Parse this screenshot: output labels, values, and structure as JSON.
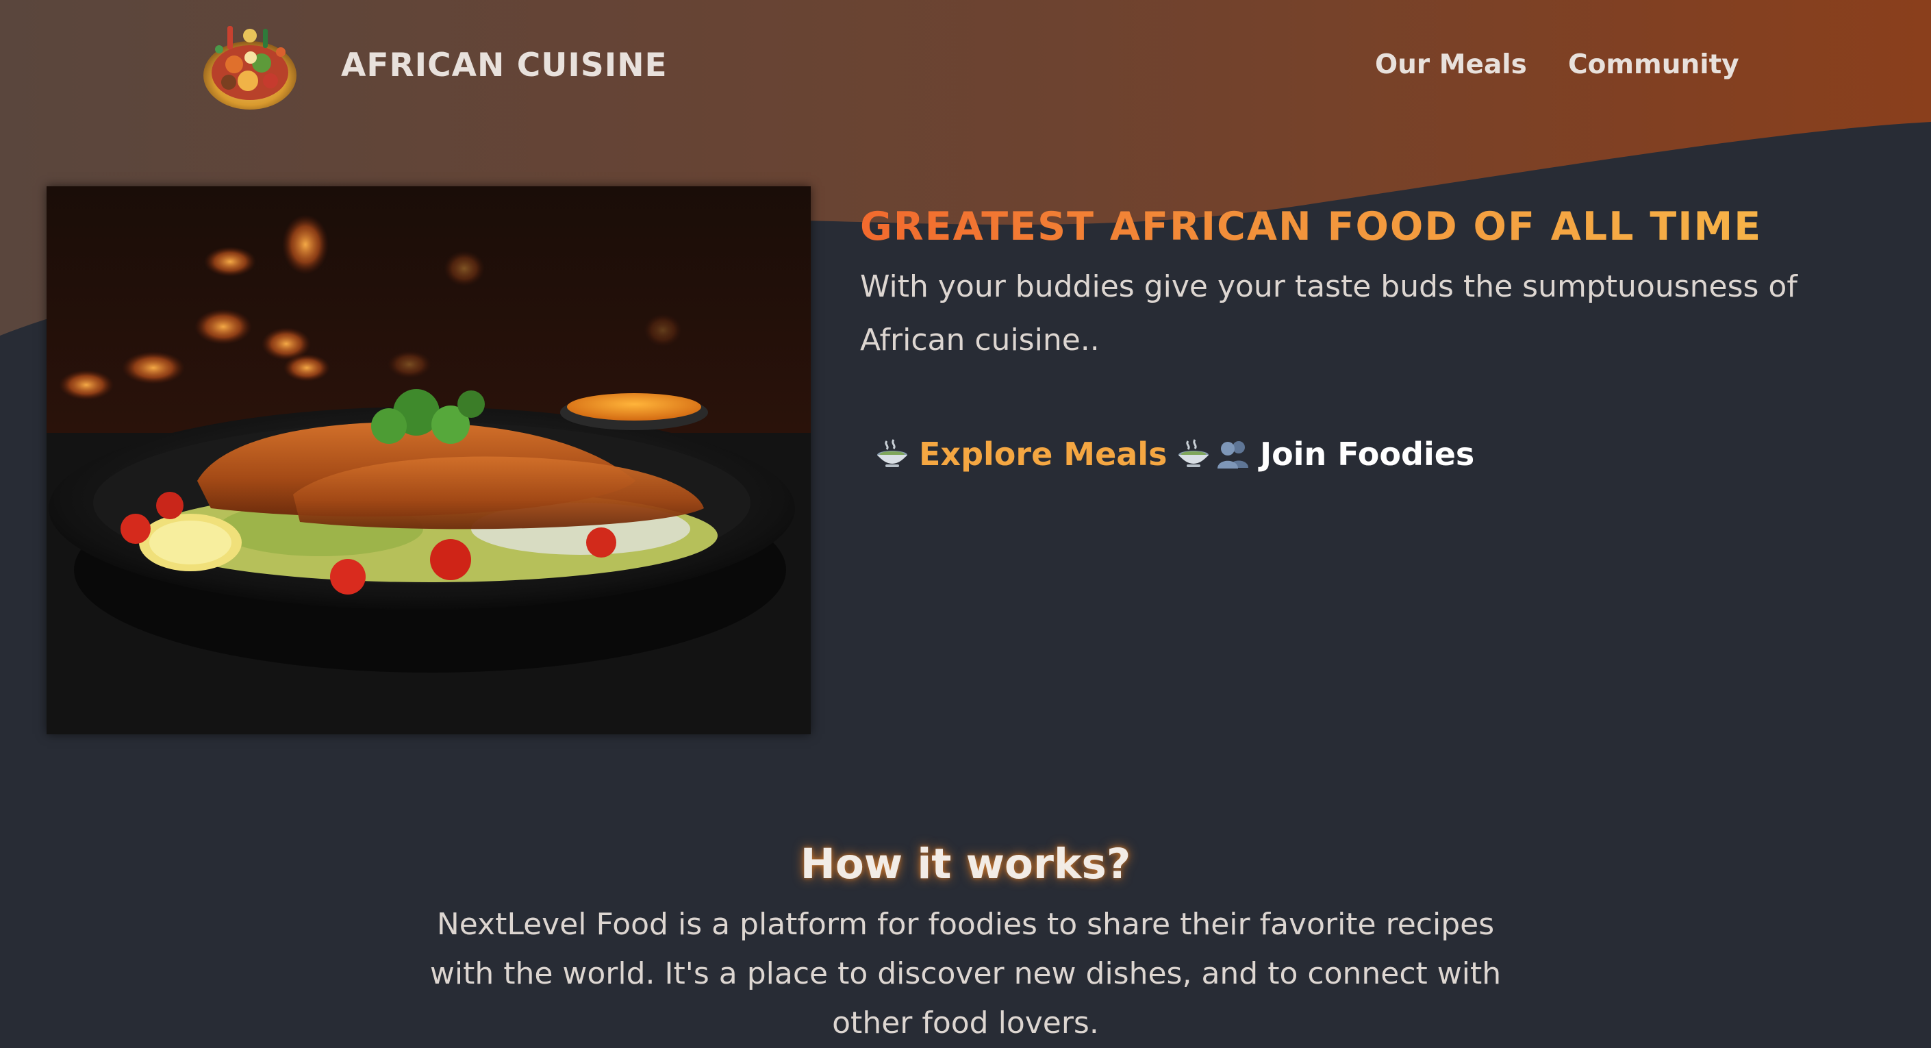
{
  "header": {
    "logo_text": "AFRICAN CUISINE",
    "nav": {
      "meals": "Our Meals",
      "community": "Community"
    }
  },
  "hero": {
    "title": "GREATEST AFRICAN FOOD OF ALL TIME",
    "subtitle": "With your buddies give your taste buds the sumptuousness of African cuisine..",
    "explore_label": "Explore Meals",
    "join_label": "Join Foodies"
  },
  "how_it_works": {
    "title": "How it works?",
    "text": "NextLevel Food is a platform for foodies to share their favorite recipes with the world. It's a place to discover new dishes, and to connect with other food lovers."
  },
  "colors": {
    "background": "#282c35",
    "header_gradient_start": "#5a463d",
    "header_gradient_end": "#8a3f1c",
    "title_gradient_start": "#f26a2e",
    "title_gradient_end": "#f7b348",
    "accent": "#f5a742"
  },
  "icons": {
    "logo": "food-platter-logo",
    "explore": "soup-bowl-icon",
    "join": "people-icon"
  }
}
